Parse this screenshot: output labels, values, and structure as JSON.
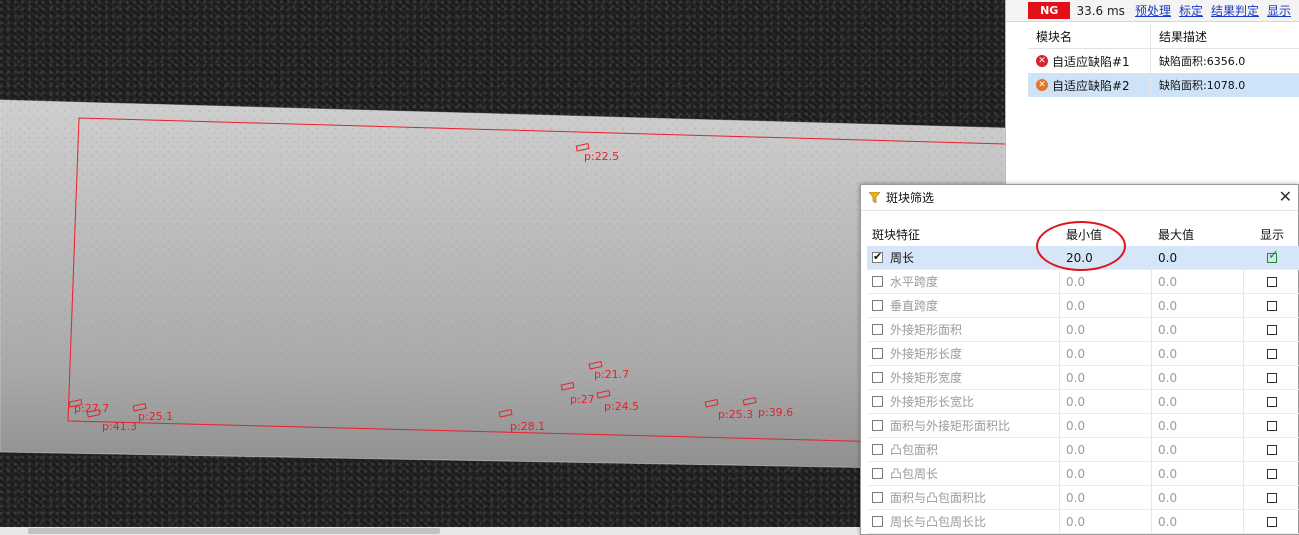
{
  "result_panel": {
    "status": "NG",
    "elapsed": "33.6 ms",
    "tool_links": [
      "预处理",
      "标定",
      "结果判定",
      "显示"
    ],
    "columns": [
      "模块名",
      "结果描述"
    ],
    "rows": [
      {
        "name": "自适应缺陷#1",
        "desc": "缺陷面积:6356.0",
        "icon": "error-icon"
      },
      {
        "name": "自适应缺陷#2",
        "desc": "缺陷面积:1078.0",
        "icon": "warning-error-icon"
      }
    ]
  },
  "dialog": {
    "title": "斑块筛选",
    "columns": {
      "feature": "斑块特征",
      "min": "最小值",
      "max": "最大值",
      "show": "显示"
    },
    "rows": [
      {
        "label": "周长",
        "min": "20.0",
        "max": "0.0",
        "checked": true
      },
      {
        "label": "水平跨度",
        "min": "0.0",
        "max": "0.0",
        "checked": false
      },
      {
        "label": "垂直跨度",
        "min": "0.0",
        "max": "0.0",
        "checked": false
      },
      {
        "label": "外接矩形面积",
        "min": "0.0",
        "max": "0.0",
        "checked": false
      },
      {
        "label": "外接矩形长度",
        "min": "0.0",
        "max": "0.0",
        "checked": false
      },
      {
        "label": "外接矩形宽度",
        "min": "0.0",
        "max": "0.0",
        "checked": false
      },
      {
        "label": "外接矩形长宽比",
        "min": "0.0",
        "max": "0.0",
        "checked": false
      },
      {
        "label": "面积与外接矩形面积比",
        "min": "0.0",
        "max": "0.0",
        "checked": false
      },
      {
        "label": "凸包面积",
        "min": "0.0",
        "max": "0.0",
        "checked": false
      },
      {
        "label": "凸包周长",
        "min": "0.0",
        "max": "0.0",
        "checked": false
      },
      {
        "label": "面积与凸包面积比",
        "min": "0.0",
        "max": "0.0",
        "checked": false
      },
      {
        "label": "周长与凸包周长比",
        "min": "0.0",
        "max": "0.0",
        "checked": false
      }
    ]
  },
  "viewer": {
    "overlay_color": "#e8202a",
    "blob_labels": [
      "p:22.5",
      "p:27.7",
      "p:25.1",
      "p:41.3",
      "p:21.7",
      "p:27",
      "p:24.5",
      "p:28.1",
      "p:25.3",
      "p:39.6"
    ]
  }
}
